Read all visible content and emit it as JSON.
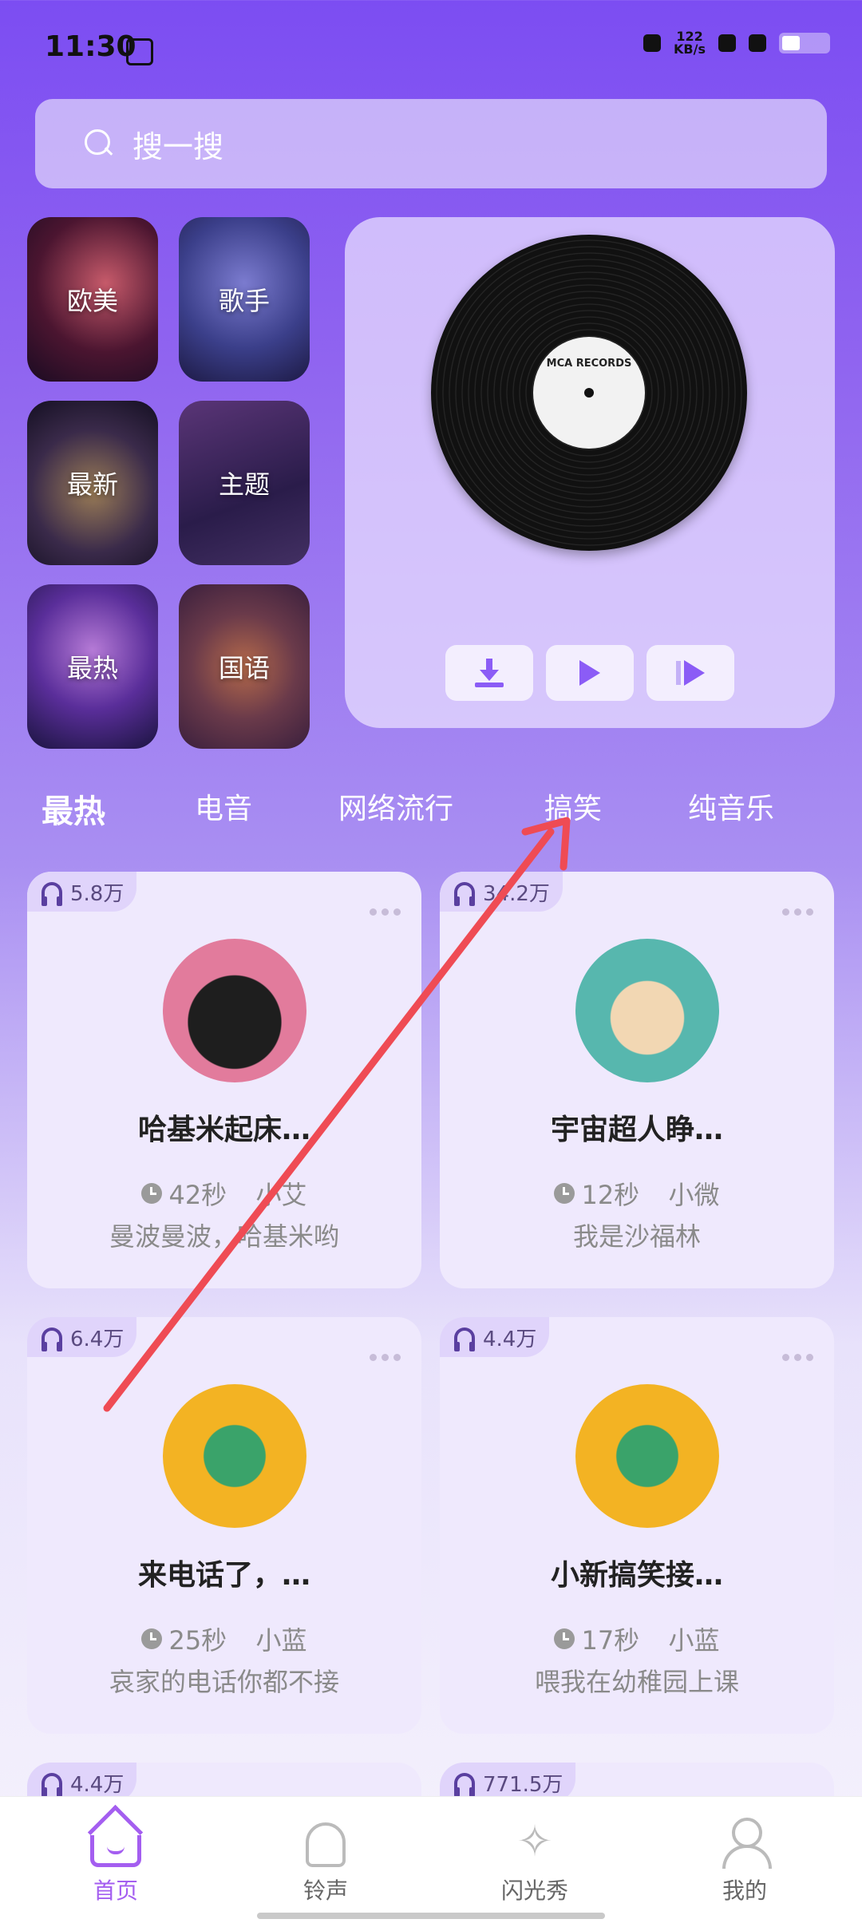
{
  "status": {
    "time": "11:30",
    "speed_top": "122",
    "speed_bottom": "KB/s"
  },
  "search": {
    "placeholder": "搜一搜"
  },
  "categories": [
    {
      "label": "欧美"
    },
    {
      "label": "歌手"
    },
    {
      "label": "最新"
    },
    {
      "label": "主题"
    },
    {
      "label": "最热"
    },
    {
      "label": "国语"
    }
  ],
  "player": {
    "record_label": "MCA RECORDS"
  },
  "tabs": [
    "最热",
    "电音",
    "网络流行",
    "搞笑",
    "纯音乐"
  ],
  "cards": [
    {
      "plays": "5.8万",
      "title": "哈基米起床…",
      "duration": "42秒",
      "author": "小艾",
      "desc": "曼波曼波，哈基米哟"
    },
    {
      "plays": "34.2万",
      "title": "宇宙超人睁…",
      "duration": "12秒",
      "author": "小微",
      "desc": "我是沙福林"
    },
    {
      "plays": "6.4万",
      "title": "来电话了，…",
      "duration": "25秒",
      "author": "小蓝",
      "desc": "哀家的电话你都不接"
    },
    {
      "plays": "4.4万",
      "title": "小新搞笑接…",
      "duration": "17秒",
      "author": "小蓝",
      "desc": "喂我在幼稚园上课"
    },
    {
      "plays": "4.4万"
    },
    {
      "plays": "771.5万"
    }
  ],
  "nav": [
    "首页",
    "铃声",
    "闪光秀",
    "我的"
  ],
  "colors": {
    "accent": "#a45ef0",
    "arrow": "#ef4b54"
  }
}
